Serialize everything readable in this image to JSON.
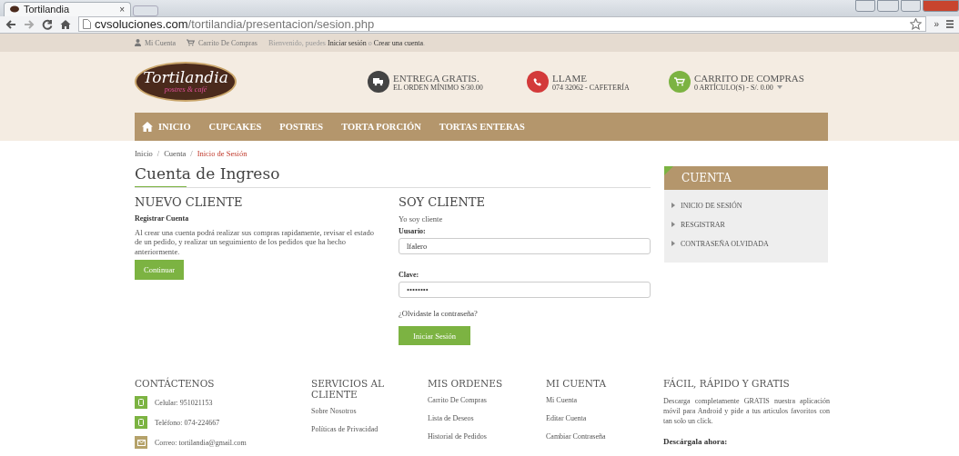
{
  "browser": {
    "tab_title": "Tortilandia",
    "tab_close": "×",
    "url_host": "cvsoluciones.com",
    "url_path": "/tortilandia/presentacion/sesion.php",
    "more": "»"
  },
  "top_bar": {
    "account": "Mi Cuenta",
    "cart": "Carrito De Compras",
    "welcome": "Bienvenido, puedes",
    "login_link": "Iniciar sesión",
    "connector": "o",
    "register_link": "Crear una cuenta",
    "end": "."
  },
  "logo": {
    "name": "Tortilandia",
    "tagline": "postres & café"
  },
  "header_info": [
    {
      "kind": "truck",
      "color": "#444444",
      "title": "ENTREGA GRATIS.",
      "detail": "EL ORDEN MÍNIMO S/30.00"
    },
    {
      "kind": "phone",
      "color": "#d33a3a",
      "title": "LLAME",
      "detail": "074 32062 - CAFETERÍA"
    },
    {
      "kind": "cart",
      "color": "#7cb342",
      "title": "CARRITO DE COMPRAS",
      "detail": "0 ARTÍCULO(S) - S/. 0.00",
      "dropdown": true
    }
  ],
  "nav": [
    {
      "label": "INICIO",
      "home": true
    },
    {
      "label": "CUPCAKES",
      "home": false
    },
    {
      "label": "POSTRES",
      "home": false
    },
    {
      "label": "TORTA PORCIÓN",
      "home": false
    },
    {
      "label": "TORTAS ENTERAS",
      "home": false
    }
  ],
  "breadcrumb": [
    {
      "label": "Inicio",
      "current": false
    },
    {
      "separator": "/",
      "label": "Cuenta",
      "current": false
    },
    {
      "separator": "/",
      "label": "Inicio de Sesión",
      "current": true
    }
  ],
  "page_title": "Cuenta de Ingreso",
  "new_customer": {
    "heading": "NUEVO CLIENTE",
    "subheading": "Registrar Cuenta",
    "text": "Al crear una cuenta podrá realizar sus compras rapidamente, revisar el estado de un pedido, y realizar un seguimiento de los pedidos que ha hecho anteriormente.",
    "button": "Continuar"
  },
  "returning_customer": {
    "heading": "SOY CLIENTE",
    "subheading": "Yo soy cliente",
    "fields": [
      {
        "label": "Uusario:",
        "value": "lfalero"
      },
      {
        "label": "Clave:",
        "value": "••••••••"
      }
    ],
    "forgot_link": "¿Olvidaste la contraseña?",
    "button": "Iniciar Sesión"
  },
  "sidebar": {
    "title": "CUENTA",
    "items": [
      "INICIO DE SESIÓN",
      "RESGISTRAR",
      "CONTRASEÑA OLVIDADA"
    ]
  },
  "footer": {
    "contact": {
      "heading": "CONTÁCTENOS",
      "items": [
        {
          "kind": "mobile",
          "color": "#7cb342",
          "text": "Celular: 951021153"
        },
        {
          "kind": "mobile",
          "color": "#7cb342",
          "text": "Teléfono: 074-224667"
        },
        {
          "kind": "mail",
          "color": "#b5a26a",
          "text": "Correo: tortilandia@gmail.com"
        }
      ]
    },
    "columns": [
      {
        "heading": "SERVICIOS AL CLIENTE",
        "links": [
          "Sobre Nosotros",
          "Políticas de Privacidad"
        ]
      },
      {
        "heading": "MIS ORDENES",
        "links": [
          "Carrito De Compras",
          "Lista de Deseos",
          "Historial de Pedidos"
        ]
      },
      {
        "heading": "MI CUENTA",
        "links": [
          "Mi Cuenta",
          "Editar Cuenta",
          "Cambiar Contraseña"
        ]
      }
    ],
    "app": {
      "heading": "FÁCIL, RÁPIDO Y GRATIS",
      "text": "Descarga completamente GRATIS nuestra aplicación móvil para Android y pide a tus articulos favoritos con tan solo un click.",
      "cta": "Descárgala ahora:"
    }
  }
}
